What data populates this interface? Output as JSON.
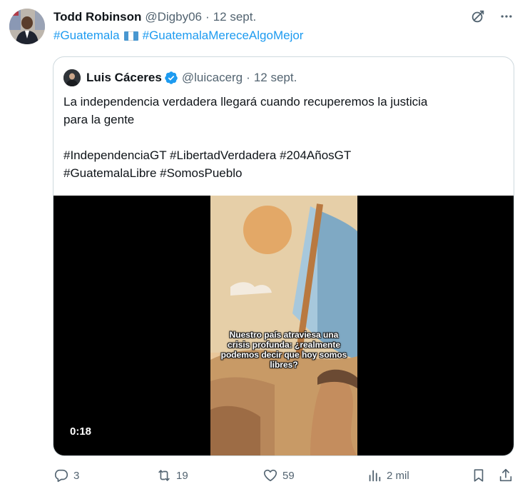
{
  "post": {
    "author_name": "Todd Robinson",
    "author_handle": "@Digby06",
    "separator": "·",
    "date": "12 sept.",
    "hashtag_1": "#Guatemala",
    "hashtag_2": "#GuatemalaMereceAlgoMejor",
    "flag_colors": [
      "#4997d0",
      "#ffffff",
      "#4997d0"
    ]
  },
  "quote": {
    "author_name": "Luis Cáceres",
    "verified": true,
    "author_handle": "@luicacerg",
    "date": "12 sept.",
    "text_lines": [
      "La independencia verdadera llegará cuando recuperemos la justicia",
      "para la gente",
      "",
      "#IndependenciaGT #LibertadVerdadera #204AñosGT",
      "#GuatemalaLibre #SomosPueblo"
    ],
    "video": {
      "caption": "Nuestro país atraviesa una crisis profunda: ¿realmente podemos decir que hoy somos libres?",
      "duration": "0:18"
    }
  },
  "actions": {
    "replies": "3",
    "reposts": "19",
    "likes": "59",
    "views": "2 mil"
  },
  "colors": {
    "accent": "#1d9bf0",
    "muted": "#536471",
    "border": "#cfd9de"
  }
}
